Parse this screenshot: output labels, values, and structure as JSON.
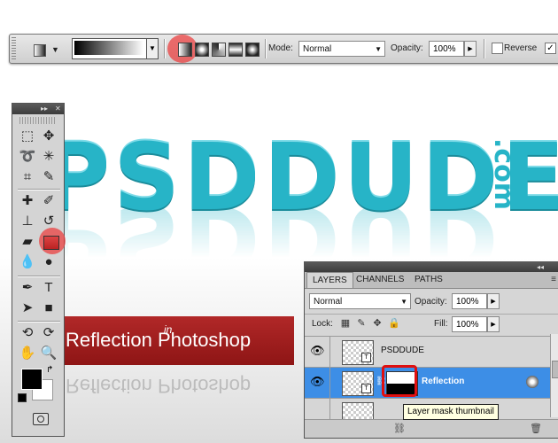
{
  "options_bar": {
    "tool_preset_icon": "gradient-tool-icon",
    "gradient_types": [
      "linear",
      "radial",
      "angle",
      "reflected",
      "diamond"
    ],
    "mode_label": "Mode:",
    "mode_value": "Normal",
    "opacity_label": "Opacity:",
    "opacity_value": "100%",
    "reverse_label": "Reverse",
    "dither_checked": true
  },
  "artwork": {
    "logo_text": "PSDDUDE",
    "logo_suffix": ".com",
    "banner_text": "Reflection Photoshop",
    "banner_small": "in",
    "logo_color": "#27b4c7",
    "banner_color": "#a01e1e"
  },
  "tools_panel": {
    "tools": [
      "marquee-icon",
      "move-icon",
      "lasso-icon",
      "magic-wand-icon",
      "crop-icon",
      "eyedropper-icon",
      "healing-brush-icon",
      "brush-icon",
      "clone-stamp-icon",
      "history-brush-icon",
      "eraser-icon",
      "gradient-icon",
      "blur-icon",
      "dodge-icon",
      "pen-icon",
      "type-icon",
      "path-selection-icon",
      "rectangle-icon",
      "3d-rotate-icon",
      "3d-orbit-icon",
      "hand-icon",
      "zoom-icon"
    ],
    "foreground": "#000000",
    "background": "#ffffff"
  },
  "layers_panel": {
    "tabs": [
      "LAYERS",
      "CHANNELS",
      "PATHS"
    ],
    "blend_mode": "Normal",
    "opacity_label": "Opacity:",
    "opacity_value": "100%",
    "lock_label": "Lock:",
    "fill_label": "Fill:",
    "fill_value": "100%",
    "layers": [
      {
        "name": "PSDDUDE",
        "selected": false
      },
      {
        "name": "Reflection",
        "selected": true
      }
    ],
    "tooltip": "Layer mask thumbnail",
    "accent": "#3d8ee6"
  }
}
